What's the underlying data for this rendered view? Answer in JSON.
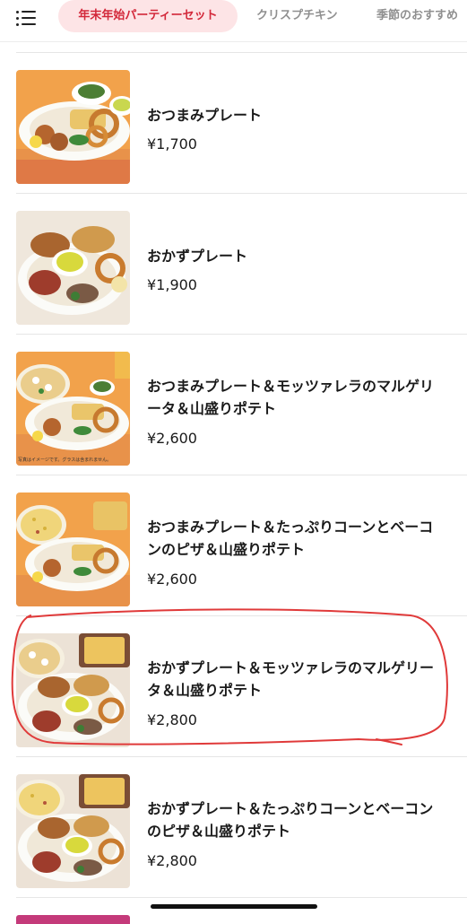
{
  "nav": {
    "tabs": [
      {
        "label": "年末年始パーティーセット",
        "active": true
      },
      {
        "label": "クリスプチキン",
        "active": false
      },
      {
        "label": "季節のおすすめ",
        "active": false
      }
    ]
  },
  "menu": {
    "items": [
      {
        "name": "おつまみプレート",
        "price": "¥1,700"
      },
      {
        "name": "おかずプレート",
        "price": "¥1,900"
      },
      {
        "name": "おつまみプレート＆モッツァレラのマルゲリータ＆山盛りポテト",
        "price": "¥2,600",
        "image_caption": "写真はイメージです。グラスは含まれません。"
      },
      {
        "name": "おつまみプレート＆たっぷりコーンとベーコンのピザ＆山盛りポテト",
        "price": "¥2,600"
      },
      {
        "name": "おかずプレート＆モッツァレラのマルゲリータ＆山盛りポテト",
        "price": "¥2,800",
        "circled": true
      },
      {
        "name": "おかずプレート＆たっぷりコーンとベーコンのピザ＆山盛りポテト",
        "price": "¥2,800"
      }
    ]
  },
  "colors": {
    "accent": "#d3283a",
    "active_tab_bg": "#fde4e6",
    "inactive_tab": "#8f8f8f",
    "annotation": "#e03a3a"
  }
}
